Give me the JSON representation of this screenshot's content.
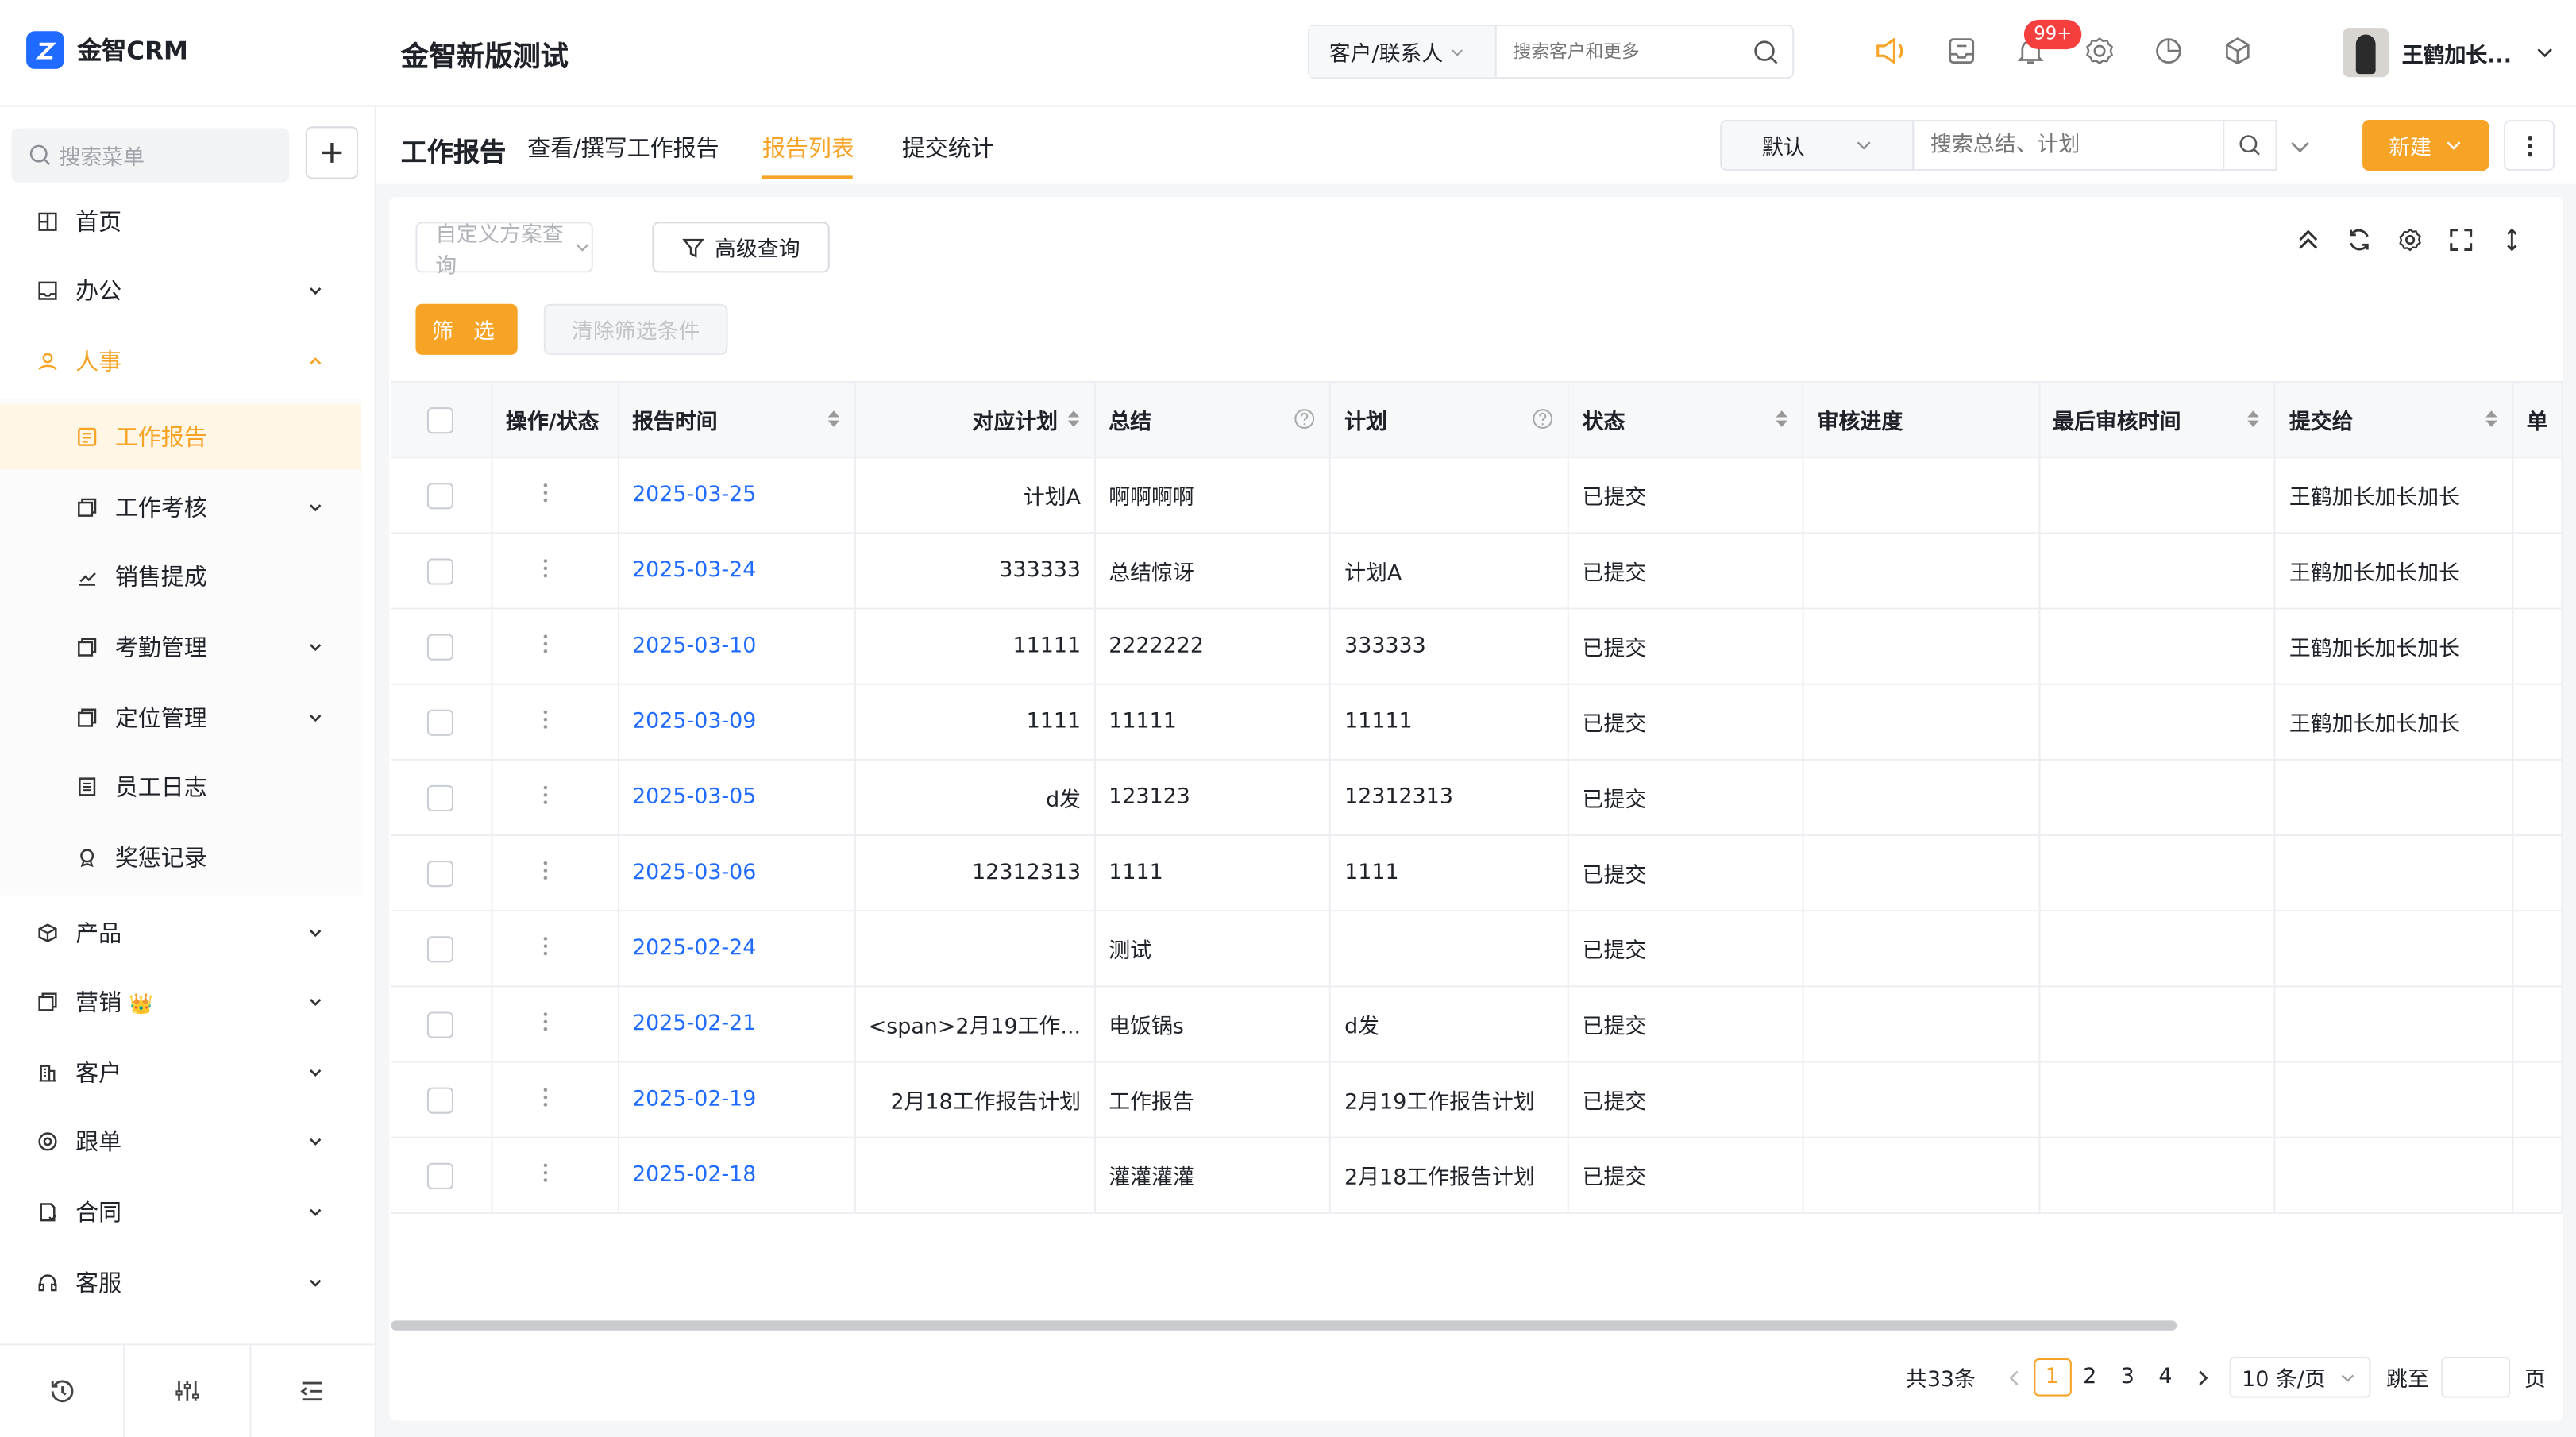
{
  "app": {
    "logo_text": "金智CRM",
    "company": "金智新版测试"
  },
  "global_search": {
    "scope": "客户/联系人",
    "placeholder": "搜索客户和更多"
  },
  "notifications": {
    "badge": "99+"
  },
  "user": {
    "name": "王鹤加长..."
  },
  "sidebar": {
    "search_placeholder": "搜索菜单",
    "items": [
      {
        "label": "首页",
        "icon": "grid-icon"
      },
      {
        "label": "办公",
        "icon": "inbox-icon",
        "expandable": true
      },
      {
        "label": "人事",
        "icon": "people-icon",
        "expanded": true
      },
      {
        "label": "工作报告",
        "icon": "report-icon",
        "active": true
      },
      {
        "label": "工作考核",
        "icon": "copy-icon",
        "expandable": true
      },
      {
        "label": "销售提成",
        "icon": "chart-icon"
      },
      {
        "label": "考勤管理",
        "icon": "copy-icon",
        "expandable": true
      },
      {
        "label": "定位管理",
        "icon": "copy-icon",
        "expandable": true
      },
      {
        "label": "员工日志",
        "icon": "log-icon"
      },
      {
        "label": "奖惩记录",
        "icon": "award-icon"
      },
      {
        "label": "产品",
        "icon": "box-icon",
        "expandable": true
      },
      {
        "label": "营销",
        "icon": "copy-icon",
        "expandable": true,
        "crown": "👑"
      },
      {
        "label": "客户",
        "icon": "building-icon",
        "expandable": true
      },
      {
        "label": "跟单",
        "icon": "target-icon",
        "expandable": true
      },
      {
        "label": "合同",
        "icon": "contract-icon",
        "expandable": true
      },
      {
        "label": "客服",
        "icon": "headset-icon",
        "expandable": true
      }
    ]
  },
  "header": {
    "page_title": "工作报告",
    "tabs": [
      "查看/撰写工作报告",
      "报告列表",
      "提交统计"
    ],
    "active_tab": "报告列表",
    "sort_option": "默认",
    "search_placeholder": "搜索总结、计划",
    "new_button": "新建"
  },
  "filters": {
    "custom_query": "自定义方案查询",
    "advanced_query": "高级查询",
    "filter_button": "筛 选",
    "clear_button": "清除筛选条件"
  },
  "table": {
    "columns": [
      "操作/状态",
      "报告时间",
      "对应计划",
      "总结",
      "计划",
      "状态",
      "审核进度",
      "最后审核时间",
      "提交给",
      "单"
    ],
    "rows": [
      {
        "date": "2025-03-25",
        "plan_ref": "计划A",
        "summary": "啊啊啊啊",
        "plan": "",
        "status": "已提交",
        "progress": "",
        "last_review": "",
        "submit_to": "王鹤加长加长加长"
      },
      {
        "date": "2025-03-24",
        "plan_ref": "333333",
        "summary": "总结惊讶",
        "plan": "计划A",
        "status": "已提交",
        "progress": "",
        "last_review": "",
        "submit_to": "王鹤加长加长加长"
      },
      {
        "date": "2025-03-10",
        "plan_ref": "11111",
        "summary": "2222222",
        "plan": "333333",
        "status": "已提交",
        "progress": "",
        "last_review": "",
        "submit_to": "王鹤加长加长加长"
      },
      {
        "date": "2025-03-09",
        "plan_ref": "1111",
        "summary": "11111",
        "plan": "11111",
        "status": "已提交",
        "progress": "",
        "last_review": "",
        "submit_to": "王鹤加长加长加长"
      },
      {
        "date": "2025-03-05",
        "plan_ref": "d发",
        "summary": "123123",
        "plan": "12312313",
        "status": "已提交",
        "progress": "",
        "last_review": "",
        "submit_to": ""
      },
      {
        "date": "2025-03-06",
        "plan_ref": "12312313",
        "summary": "1111",
        "plan": "1111",
        "status": "已提交",
        "progress": "",
        "last_review": "",
        "submit_to": ""
      },
      {
        "date": "2025-02-24",
        "plan_ref": "",
        "summary": "测试",
        "plan": "",
        "status": "已提交",
        "progress": "",
        "last_review": "",
        "submit_to": ""
      },
      {
        "date": "2025-02-21",
        "plan_ref": "<span>2月19工作...",
        "summary": "电饭锅s",
        "plan": "d发",
        "status": "已提交",
        "progress": "",
        "last_review": "",
        "submit_to": ""
      },
      {
        "date": "2025-02-19",
        "plan_ref": "2月18工作报告计划",
        "summary": "工作报告",
        "plan": "2月19工作报告计划",
        "status": "已提交",
        "progress": "",
        "last_review": "",
        "submit_to": ""
      },
      {
        "date": "2025-02-18",
        "plan_ref": "",
        "summary": "灌灌灌灌",
        "plan": "2月18工作报告计划",
        "status": "已提交",
        "progress": "",
        "last_review": "",
        "submit_to": ""
      }
    ]
  },
  "pagination": {
    "total": "共33条",
    "pages": [
      "1",
      "2",
      "3",
      "4"
    ],
    "current": "1",
    "page_size": "10 条/页",
    "jump_label": "跳至",
    "page_unit": "页"
  },
  "colors": {
    "accent": "#f7a325",
    "link": "#1f6bff",
    "badge": "#f53f3f"
  }
}
